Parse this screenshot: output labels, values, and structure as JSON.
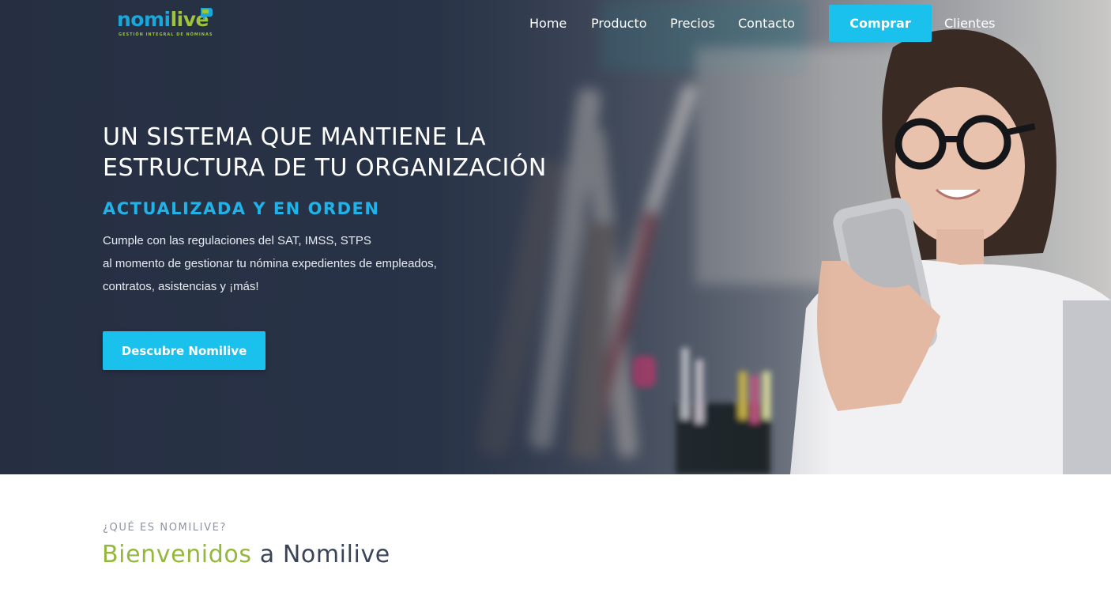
{
  "brand": {
    "logo_part1": "nomi",
    "logo_part2": "live",
    "logo_tagline": "GESTIÓN INTEGRAL DE NÓMINAS"
  },
  "nav": {
    "home": "Home",
    "producto": "Producto",
    "precios": "Precios",
    "contacto": "Contacto",
    "comprar": "Comprar",
    "clientes": "Clientes"
  },
  "hero": {
    "title_line1": "UN SISTEMA QUE MANTIENE LA",
    "title_line2": "ESTRUCTURA DE TU ORGANIZACIÓN",
    "subtitle": "ACTUALIZADA Y EN ORDEN",
    "desc_line1": "Cumple con las regulaciones del SAT, IMSS, STPS",
    "desc_line2": "al momento de gestionar tu nómina expedientes de empleados,",
    "desc_line3": "contratos, asistencias y ¡más!",
    "cta": "Descubre Nomilive"
  },
  "welcome": {
    "kicker": "¿QUÉ ES NOMILIVE?",
    "heading_part1": "Bienvenidos",
    "heading_part2": " a Nomilive"
  },
  "colors": {
    "accent": "#19c1ec",
    "brand_blue": "#1ba7d8",
    "brand_green": "#9cc53c",
    "hero_dark": "#2a3346"
  }
}
